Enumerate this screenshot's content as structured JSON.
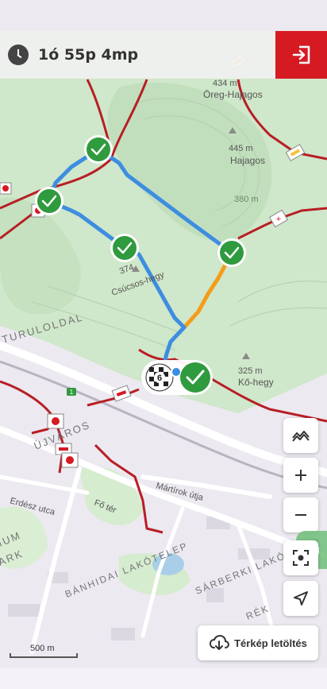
{
  "topbar": {
    "timer_text": "1ó 55p 4mp",
    "exit_icon": "exit-icon"
  },
  "map": {
    "peaks": [
      {
        "elev": "434 m",
        "name": "Öreg-Hajagos"
      },
      {
        "elev": "445 m",
        "name": "Hajagos"
      },
      {
        "elev": "374",
        "name": "Csúcsos-hegy"
      },
      {
        "elev": "325 m",
        "name": "Kő-hegy"
      }
    ],
    "contour_label": "380 m",
    "areas": [
      "TURULOLDAL",
      "ÚJVÁROS",
      "BÁNHIDAI LAKÓTELEP",
      "SÁRBERKI LAKÓTELEP",
      "RÉK"
    ],
    "streets": [
      "Fő tér",
      "Mártírok útja",
      "Erdész utca"
    ],
    "partial_labels": [
      "IUM",
      "ARK",
      "RÉK"
    ],
    "road_shield": "1",
    "checkpoint_number": "6",
    "colors": {
      "forest": "#cde6c8",
      "urban": "#ece9f0",
      "route_done": "#3d8ee0",
      "route_next": "#f59c1a",
      "trail": "#b81e24",
      "checkpoint": "#2f9a3e",
      "accent": "#d61a22"
    }
  },
  "controls": {
    "terrain_icon": "terrain-icon",
    "zoom_in_icon": "plus-icon",
    "zoom_out_icon": "minus-icon",
    "locate_icon": "focus-icon",
    "navigate_icon": "navigation-arrow-icon"
  },
  "download": {
    "label": "Térkép letöltés",
    "icon": "cloud-download-icon"
  },
  "scale": {
    "label": "500 m"
  }
}
